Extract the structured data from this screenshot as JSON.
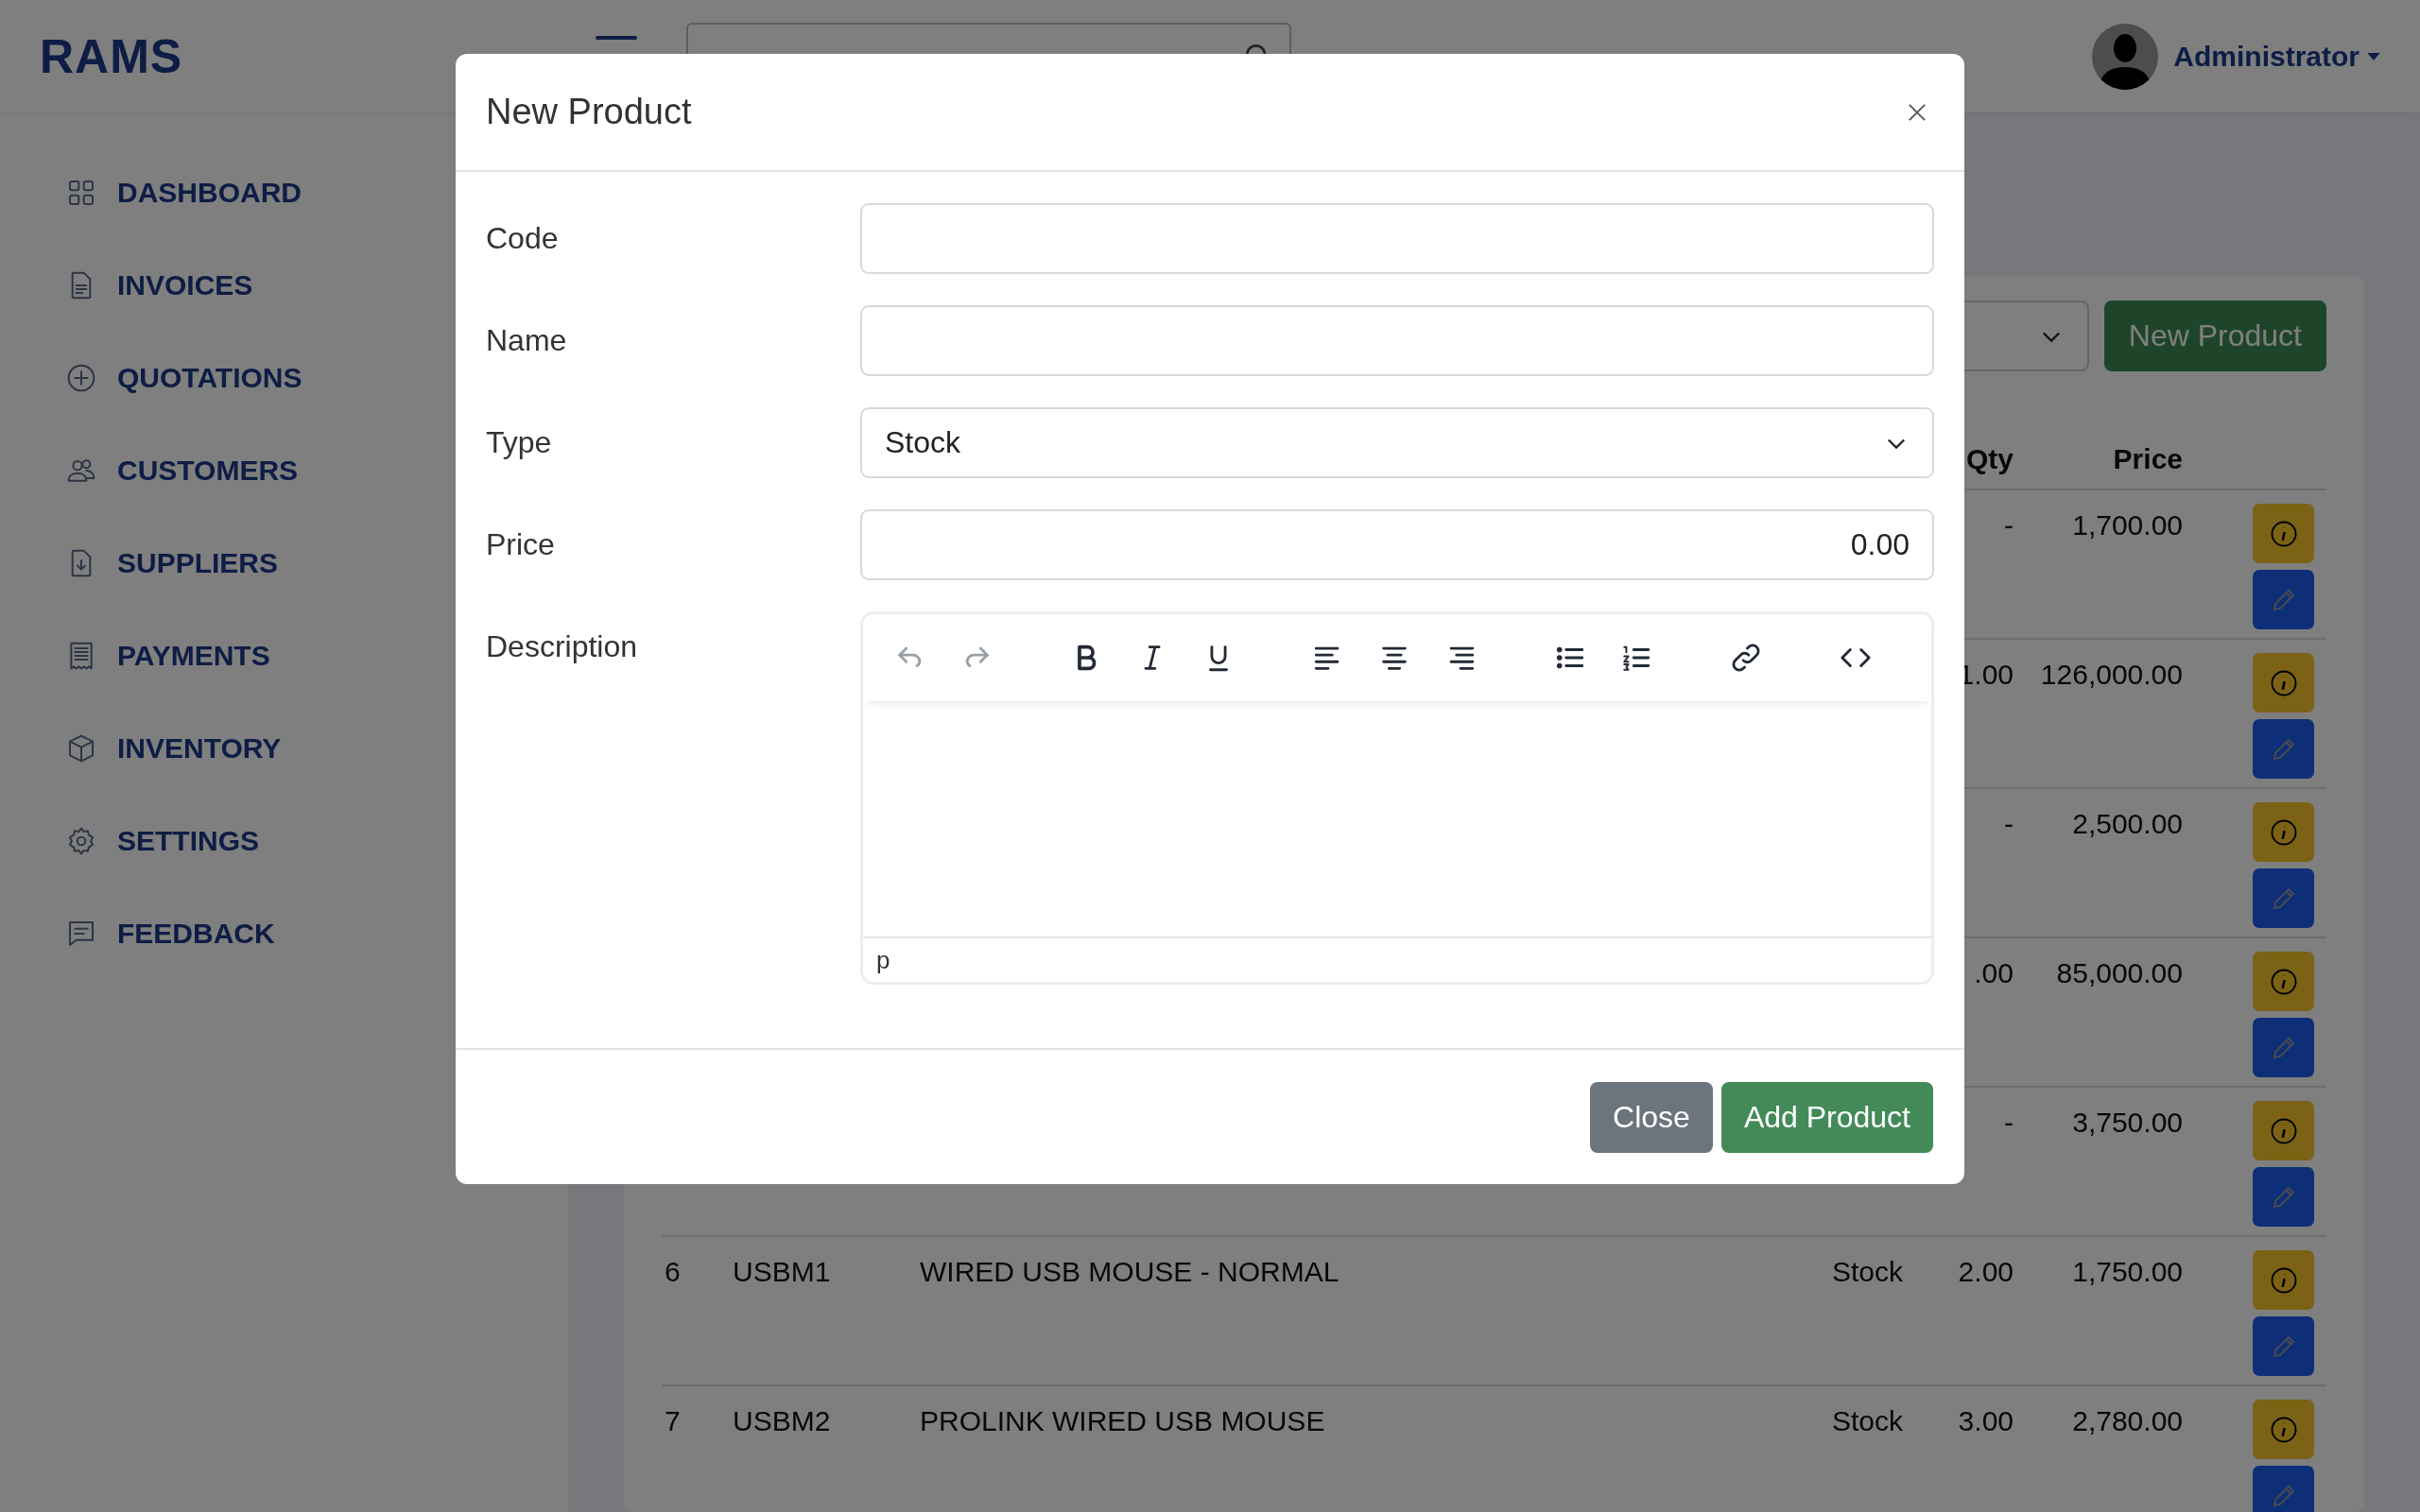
{
  "app": {
    "logo": "RAMS"
  },
  "user": {
    "name": "Administrator"
  },
  "sidebar": {
    "items": [
      {
        "label": "DASHBOARD"
      },
      {
        "label": "INVOICES"
      },
      {
        "label": "QUOTATIONS"
      },
      {
        "label": "CUSTOMERS"
      },
      {
        "label": "SUPPLIERS"
      },
      {
        "label": "PAYMENTS"
      },
      {
        "label": "INVENTORY"
      },
      {
        "label": "SETTINGS"
      },
      {
        "label": "FEEDBACK"
      }
    ]
  },
  "toolbar": {
    "button": "New Product"
  },
  "table": {
    "columns": [
      {
        "label": "Qty"
      },
      {
        "label": "Price"
      }
    ],
    "rows": [
      {
        "qty": "-",
        "price": "1,700.00"
      },
      {
        "qty": "1.00",
        "price": "126,000.00"
      },
      {
        "qty": "-",
        "price": "2,500.00"
      },
      {
        "qty": ".00",
        "price": "85,000.00"
      },
      {
        "qty": "-",
        "price": "3,750.00"
      },
      {
        "number": "6",
        "code": "USBM1",
        "name": "WIRED USB MOUSE - NORMAL",
        "type": "Stock",
        "qty": "2.00",
        "price": "1,750.00"
      },
      {
        "number": "7",
        "code": "USBM2",
        "name": "PROLINK WIRED USB MOUSE",
        "type": "Stock",
        "qty": "3.00",
        "price": "2,780.00"
      }
    ]
  },
  "modal": {
    "title": "New Product",
    "fields": [
      {
        "label": "Code",
        "kind": "text"
      },
      {
        "label": "Name",
        "kind": "text"
      },
      {
        "label": "Type",
        "kind": "select",
        "value": "Stock"
      },
      {
        "label": "Price",
        "kind": "number",
        "value": "0.00"
      },
      {
        "label": "Description",
        "kind": "editor",
        "status": "p"
      }
    ],
    "editor_tools": [
      {
        "disabled": true
      },
      {
        "disabled": true
      },
      {
        "disabled": false
      },
      {
        "disabled": false
      },
      {
        "disabled": false
      },
      {
        "disabled": false
      },
      {
        "disabled": false
      },
      {
        "disabled": false
      },
      {
        "disabled": false
      },
      {
        "disabled": false
      },
      {
        "disabled": false
      },
      {
        "disabled": false
      }
    ],
    "buttons": [
      {
        "label": "Close",
        "kind": "secondary"
      },
      {
        "label": "Add Product",
        "kind": "primary"
      }
    ]
  }
}
